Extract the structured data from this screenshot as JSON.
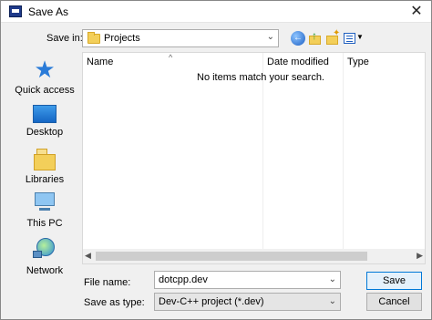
{
  "window": {
    "title": "Save As"
  },
  "toolbar": {
    "save_in_label": "Save in:",
    "save_in_value": "Projects",
    "icons": [
      "back-icon",
      "up-folder-icon",
      "new-folder-icon",
      "views-menu-icon"
    ]
  },
  "places": {
    "items": [
      {
        "label": "Quick access",
        "icon": "quick-access-icon"
      },
      {
        "label": "Desktop",
        "icon": "desktop-icon"
      },
      {
        "label": "Libraries",
        "icon": "libraries-icon"
      },
      {
        "label": "This PC",
        "icon": "this-pc-icon"
      },
      {
        "label": "Network",
        "icon": "network-icon"
      }
    ]
  },
  "filelist": {
    "columns": [
      "Name",
      "Date modified",
      "Type"
    ],
    "empty_message": "No items match your search."
  },
  "form": {
    "file_name_label": "File name:",
    "file_name_value": "dotcpp.dev",
    "save_type_label": "Save as type:",
    "save_type_value": "Dev-C++ project (*.dev)"
  },
  "buttons": {
    "save": "Save",
    "cancel": "Cancel"
  },
  "colors": {
    "accent": "#0078d7",
    "folder": "#f3cf5a",
    "scroll_thumb": "#cdcdcd"
  }
}
